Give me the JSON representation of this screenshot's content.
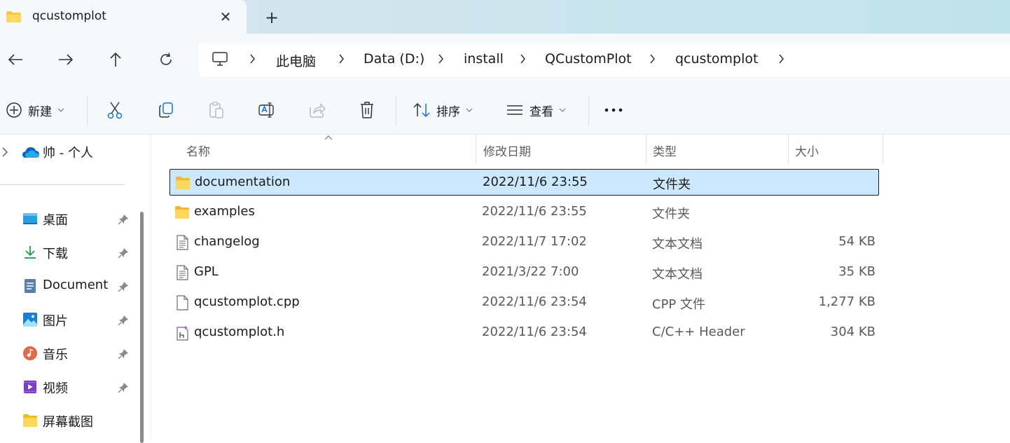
{
  "tab": {
    "title": "qcustomplot",
    "close_glyph": "✕",
    "new_tab_glyph": "+"
  },
  "breadcrumb": [
    "此电脑",
    "Data (D:)",
    "install",
    "QCustomPlot",
    "qcustomplot"
  ],
  "commands": {
    "new_label": "新建",
    "sort_label": "排序",
    "view_label": "查看",
    "more_glyph": "•••"
  },
  "sidebar": {
    "onedrive_label": "帅 - 个人",
    "items": [
      {
        "label": "桌面",
        "icon": "desktop-icon"
      },
      {
        "label": "下载",
        "icon": "download-icon"
      },
      {
        "label": "Document",
        "icon": "document-icon"
      },
      {
        "label": "图片",
        "icon": "pictures-icon"
      },
      {
        "label": "音乐",
        "icon": "music-icon"
      },
      {
        "label": "视频",
        "icon": "videos-icon"
      },
      {
        "label": "屏幕截图",
        "icon": "folder-icon"
      }
    ]
  },
  "columns": {
    "name": "名称",
    "date": "修改日期",
    "type": "类型",
    "size": "大小"
  },
  "files": [
    {
      "name": "documentation",
      "date": "2022/11/6 23:55",
      "type": "文件夹",
      "size": "",
      "icon": "folder-icon",
      "selected": true
    },
    {
      "name": "examples",
      "date": "2022/11/6 23:55",
      "type": "文件夹",
      "size": "",
      "icon": "folder-icon",
      "selected": false
    },
    {
      "name": "changelog",
      "date": "2022/11/7 17:02",
      "type": "文本文档",
      "size": "54 KB",
      "icon": "text-file-icon",
      "selected": false
    },
    {
      "name": "GPL",
      "date": "2021/3/22 7:00",
      "type": "文本文档",
      "size": "35 KB",
      "icon": "text-file-icon",
      "selected": false
    },
    {
      "name": "qcustomplot.cpp",
      "date": "2022/11/6 23:54",
      "type": "CPP 文件",
      "size": "1,277 KB",
      "icon": "blank-file-icon",
      "selected": false
    },
    {
      "name": "qcustomplot.h",
      "date": "2022/11/6 23:54",
      "type": "C/C++ Header",
      "size": "304 KB",
      "icon": "header-file-icon",
      "selected": false
    }
  ],
  "colors": {
    "selection": "#cce8ff",
    "folder": "#f8c93e",
    "accent": "#0a64c2"
  }
}
